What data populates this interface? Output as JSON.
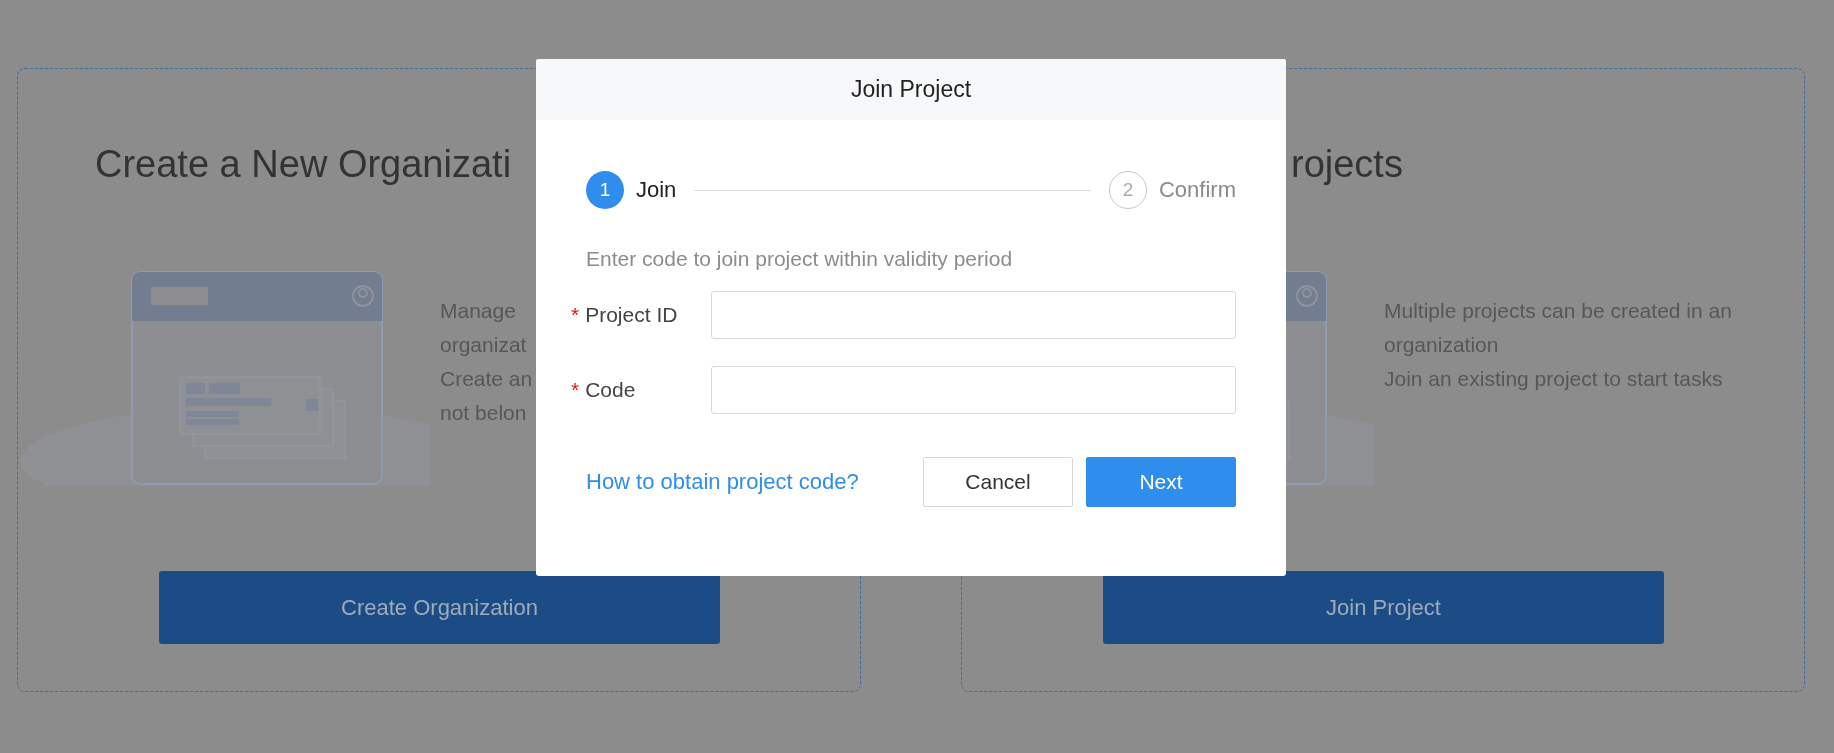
{
  "cards": [
    {
      "title": "Create a New Organizati",
      "description": [
        "Manage",
        "organizat",
        "Create an",
        "not belon"
      ],
      "button": "Create Organization"
    },
    {
      "title": "rojects",
      "description": [
        "Multiple projects can be created in an organization",
        "Join an existing project to start tasks"
      ],
      "button": "Join Project"
    }
  ],
  "dialog": {
    "title": "Join Project",
    "steps": [
      {
        "number": "1",
        "label": "Join",
        "selected": true
      },
      {
        "number": "2",
        "label": "Confirm",
        "selected": false
      }
    ],
    "hint": "Enter code to join project within validity period",
    "fields": [
      {
        "marker": "*",
        "label": "Project ID"
      },
      {
        "marker": "*",
        "label": "Code"
      }
    ],
    "help_link": "How to obtain project code?",
    "buttons": [
      {
        "label": "Cancel",
        "kind": "default"
      },
      {
        "label": "Next",
        "kind": "primary"
      }
    ]
  }
}
